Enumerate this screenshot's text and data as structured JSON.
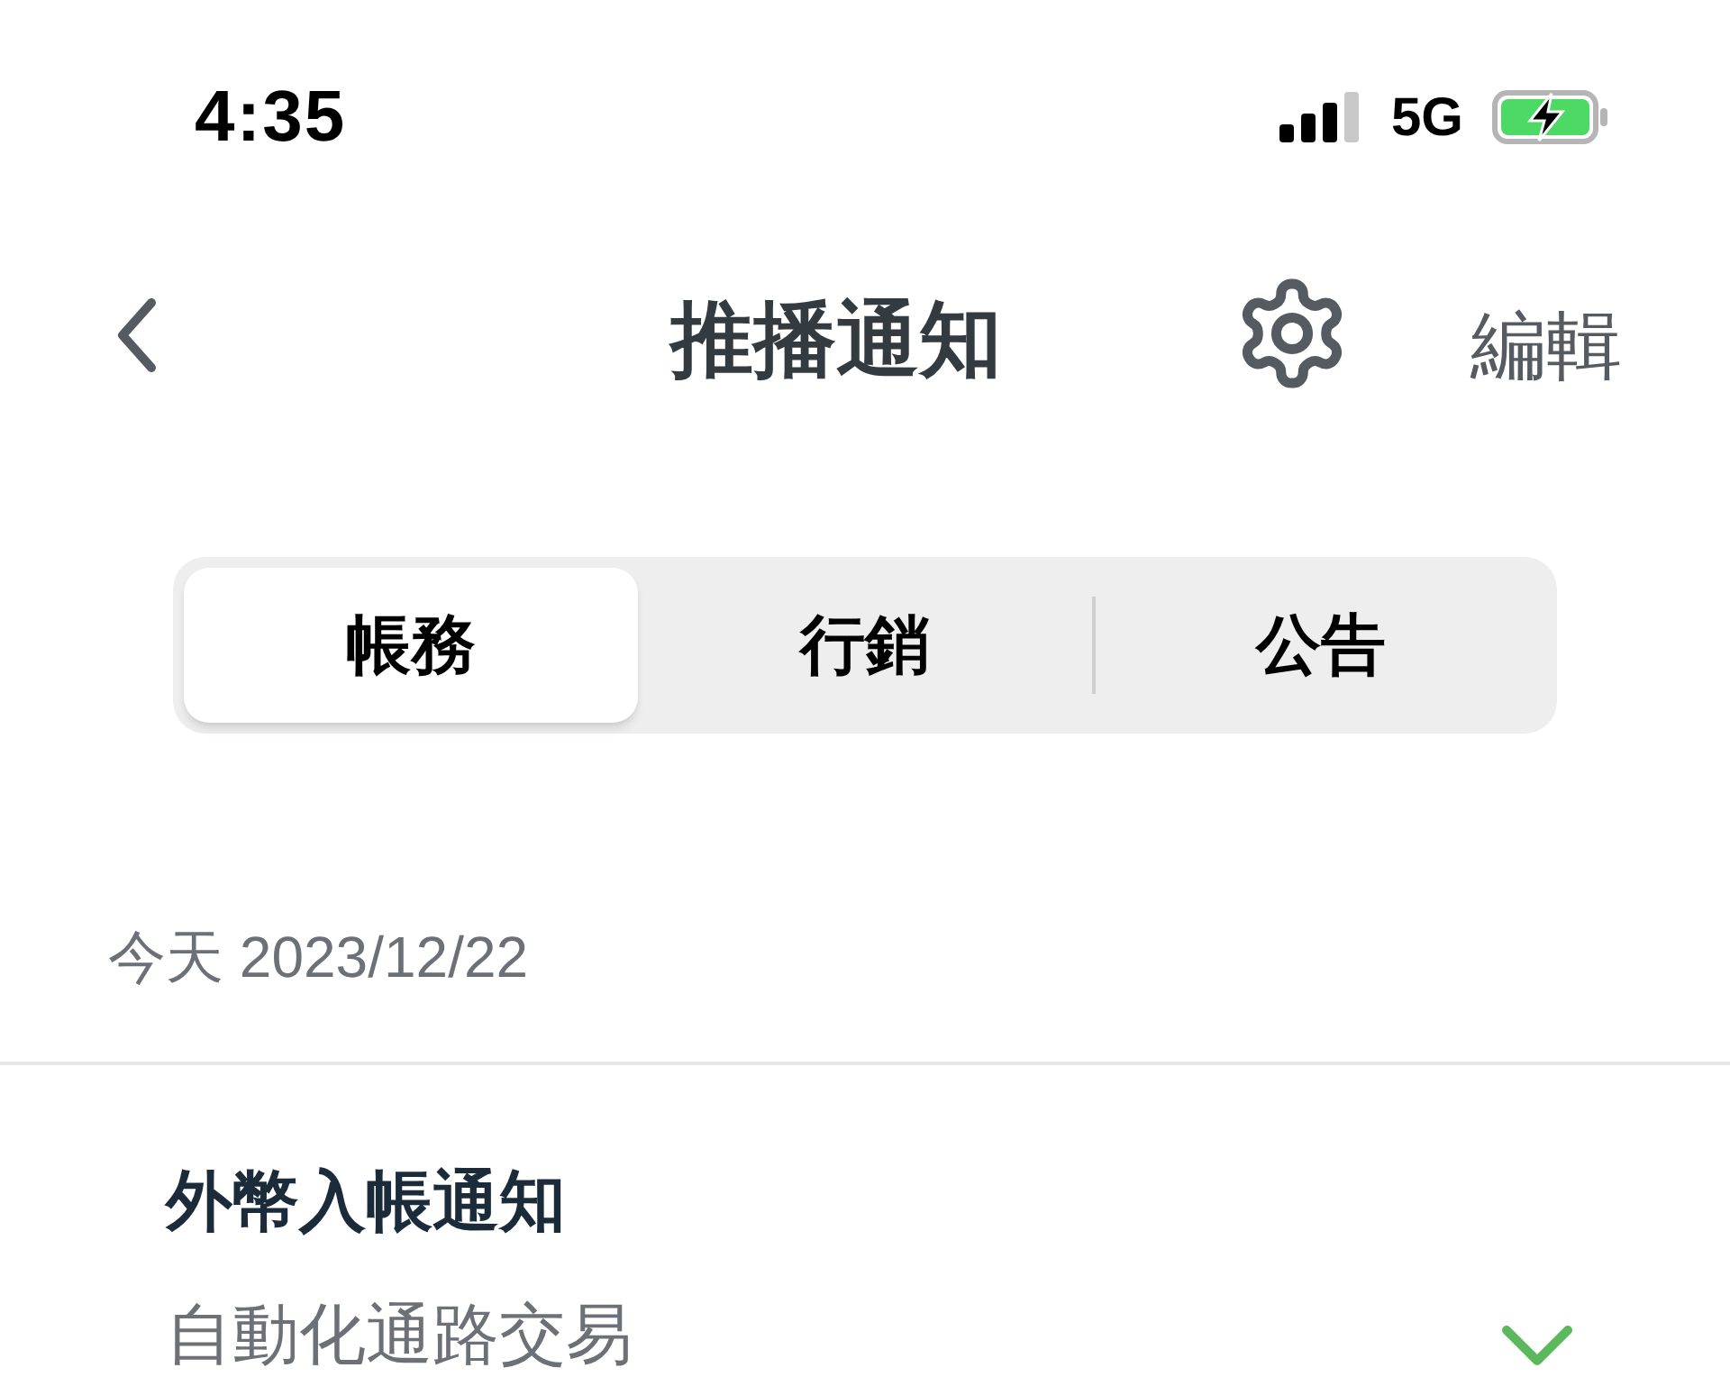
{
  "status_bar": {
    "time": "4:35",
    "network": "5G"
  },
  "nav": {
    "title": "推播通知",
    "edit": "編輯"
  },
  "tabs": [
    {
      "label": "帳務",
      "selected": true
    },
    {
      "label": "行銷",
      "selected": false
    },
    {
      "label": "公告",
      "selected": false
    }
  ],
  "sections": [
    {
      "header": "今天 2023/12/22",
      "items": [
        {
          "title": "外幣入帳通知",
          "subtitle": "自動化通路交易",
          "expanded": false
        }
      ]
    }
  ]
}
